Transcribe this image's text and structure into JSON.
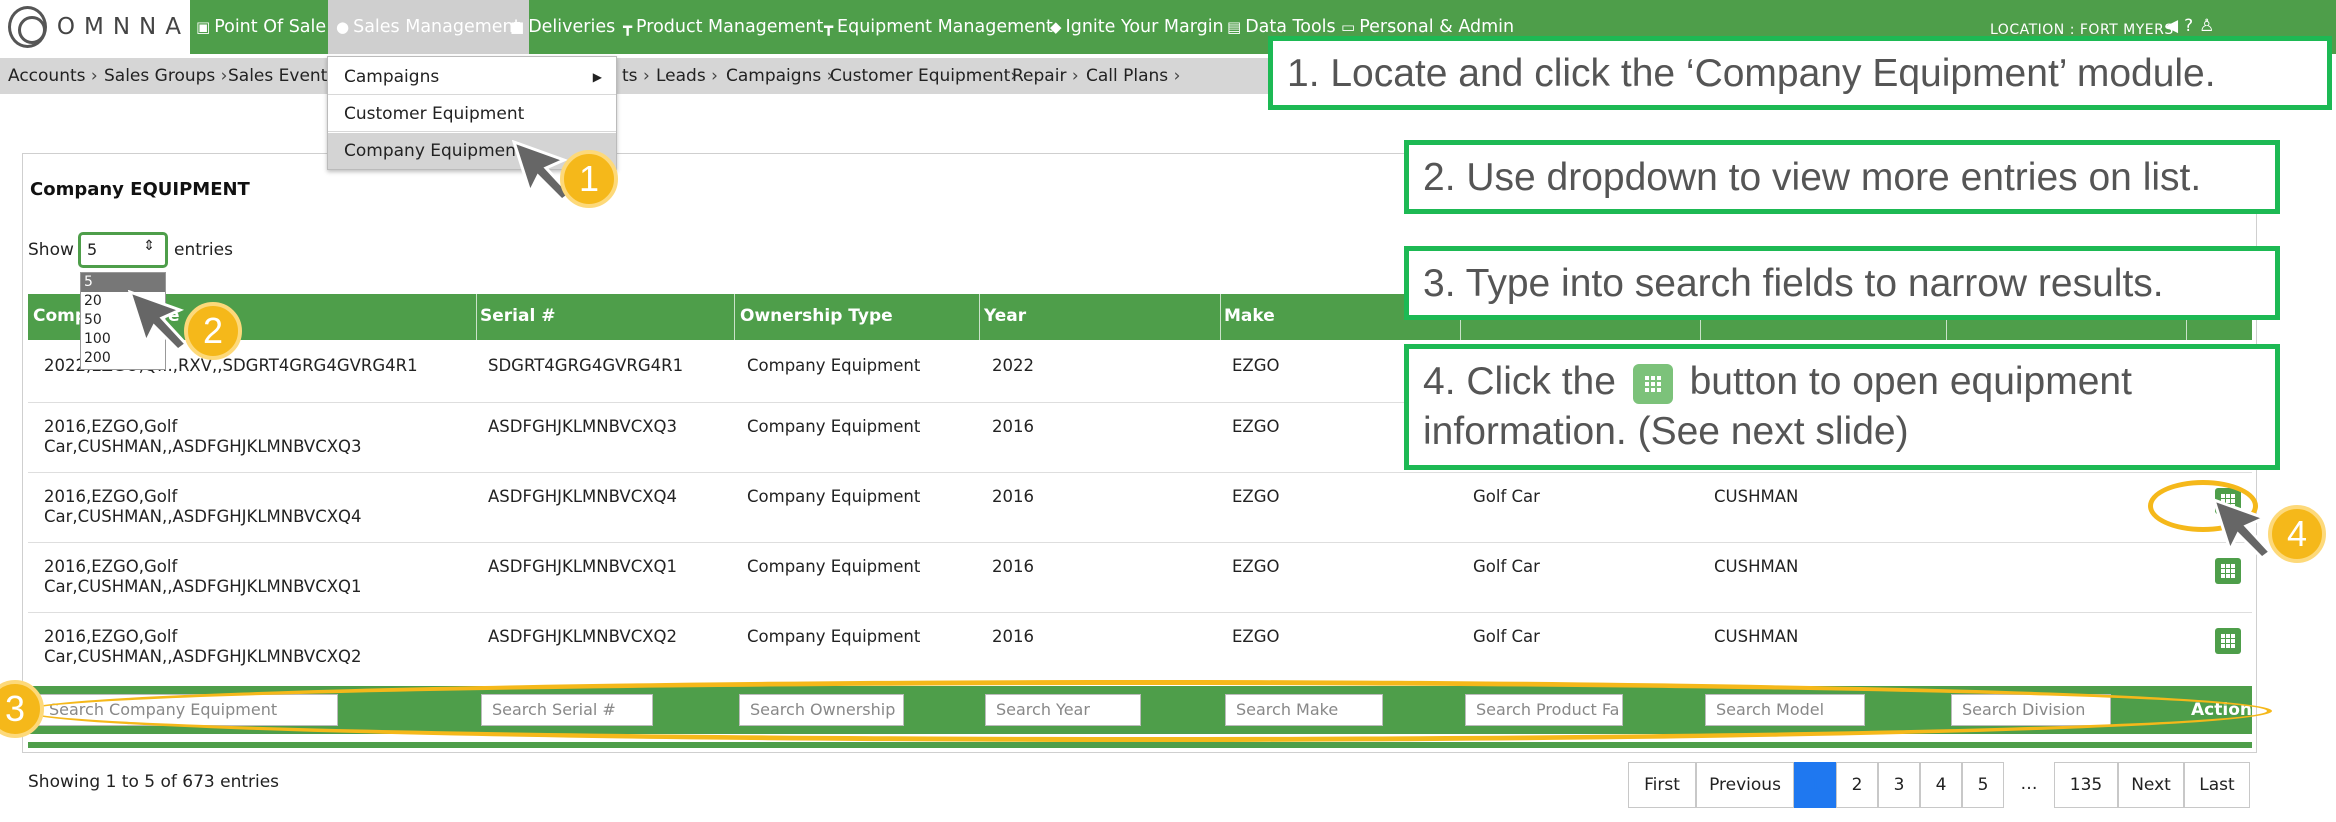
{
  "brand": {
    "logo_text": "OMNNA"
  },
  "nav": {
    "items": [
      {
        "label": "Point Of Sale",
        "icon": "cart-icon"
      },
      {
        "label": "Sales Management",
        "icon": "user-icon"
      },
      {
        "label": "Deliveries",
        "icon": "truck-icon"
      },
      {
        "label": "Product Management",
        "icon": "sitemap-icon"
      },
      {
        "label": "Equipment Management",
        "icon": "sitemap-icon"
      },
      {
        "label": "Ignite Your Margin",
        "icon": "tag-icon"
      },
      {
        "label": "Data Tools",
        "icon": "database-icon"
      },
      {
        "label": "Personal & Admin",
        "icon": "id-card-icon"
      }
    ],
    "location": "LOCATION : FORT MYERS"
  },
  "breadcrumb": {
    "items": [
      "Accounts",
      "Sales Groups",
      "Sales Events",
      "ts",
      "Leads",
      "Campaigns",
      "Customer Equipment",
      "Repair",
      "Call Plans"
    ],
    "separator": "›"
  },
  "dropdown": {
    "items": [
      "Campaigns",
      "Customer Equipment",
      "Company Equipment"
    ],
    "submenu_arrow": "▶"
  },
  "panel": {
    "title": "Company EQUIPMENT",
    "show_label": "Show",
    "entries_label": "entries",
    "page_length": "5",
    "page_length_options": [
      "5",
      "20",
      "50",
      "100",
      "200"
    ]
  },
  "table": {
    "headers": [
      "Comp",
      "e",
      "Serial #",
      "Ownership Type",
      "Year",
      "Make"
    ],
    "rows": [
      {
        "name1": "2022,EZGO,Q...,RXV,,SDGRT4GRG4GVRG4R1",
        "name2": "",
        "serial": "SDGRT4GRG4GVRG4R1",
        "ownership": "Company Equipment",
        "year": "2022",
        "make": "EZGO",
        "product_family": "",
        "model": ""
      },
      {
        "name1": "2016,EZGO,Golf",
        "name2": "Car,CUSHMAN,,ASDFGHJKLMNBVCXQ3",
        "serial": "ASDFGHJKLMNBVCXQ3",
        "ownership": "Company Equipment",
        "year": "2016",
        "make": "EZGO",
        "product_family": "",
        "model": ""
      },
      {
        "name1": "2016,EZGO,Golf",
        "name2": "Car,CUSHMAN,,ASDFGHJKLMNBVCXQ4",
        "serial": "ASDFGHJKLMNBVCXQ4",
        "ownership": "Company Equipment",
        "year": "2016",
        "make": "EZGO",
        "product_family": "Golf Car",
        "model": "CUSHMAN"
      },
      {
        "name1": "2016,EZGO,Golf",
        "name2": "Car,CUSHMAN,,ASDFGHJKLMNBVCXQ1",
        "serial": "ASDFGHJKLMNBVCXQ1",
        "ownership": "Company Equipment",
        "year": "2016",
        "make": "EZGO",
        "product_family": "Golf Car",
        "model": "CUSHMAN"
      },
      {
        "name1": "2016,EZGO,Golf",
        "name2": "Car,CUSHMAN,,ASDFGHJKLMNBVCXQ2",
        "serial": "ASDFGHJKLMNBVCXQ2",
        "ownership": "Company Equipment",
        "year": "2016",
        "make": "EZGO",
        "product_family": "Golf Car",
        "model": "CUSHMAN"
      }
    ],
    "search_placeholders": [
      "Search Company Equipment",
      "Search Serial #",
      "Search Ownership",
      "Search Year",
      "Search Make",
      "Search Product Fa",
      "Search Model",
      "Search Division"
    ],
    "action_label": "Action"
  },
  "footer": {
    "info": "Showing 1 to 5 of 673 entries",
    "pagination": [
      "First",
      "Previous",
      "1",
      "2",
      "3",
      "4",
      "5",
      "…",
      "135",
      "Next",
      "Last"
    ],
    "current_page": "1"
  },
  "annotations": {
    "step1": "1. Locate and click the ‘Company Equipment’ module.",
    "step2": "2. Use dropdown to view more entries on list.",
    "step3": "3. Type into search fields to narrow results.",
    "step4_a": "4. Click the",
    "step4_b": "button to open equipment",
    "step4_c": "information. (See next slide)",
    "badges": [
      "1",
      "2",
      "3",
      "4"
    ]
  },
  "colors": {
    "nav_green": "#4e9e4a",
    "callout_border": "#1db954",
    "badge": "#f5b81a",
    "page_active": "#1f78f0"
  }
}
